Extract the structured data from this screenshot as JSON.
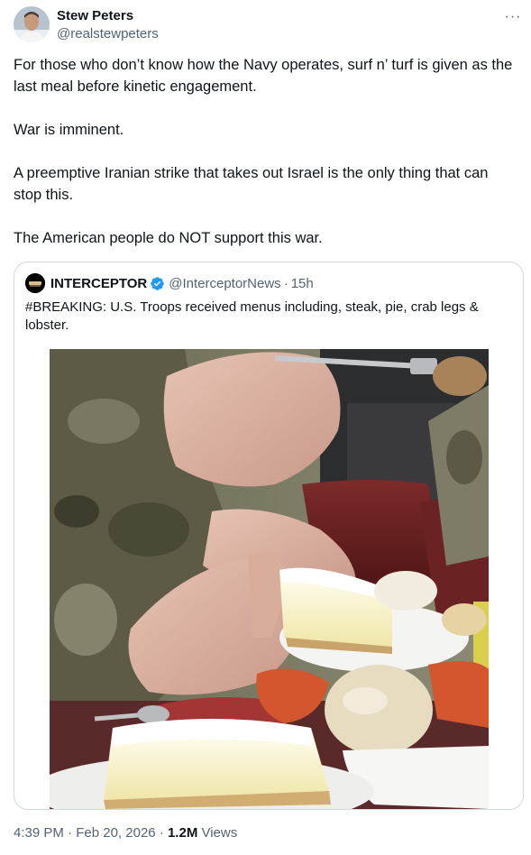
{
  "author": {
    "name": "Stew Peters",
    "handle": "@realstewpeters"
  },
  "more_label": "···",
  "tweet": {
    "paragraphs": [
      "For those who don’t know how the Navy operates, surf n’ turf is given as the last meal before kinetic engagement.",
      "War is imminent.",
      "A preemptive Iranian strike that takes out Israel is the only thing that can stop this.",
      "The American people do NOT support this war."
    ]
  },
  "quote": {
    "name": "INTERCEPTOR",
    "handle": "@InterceptorNews",
    "separator": "·",
    "time": "15h",
    "text": "#BREAKING: U.S. Troops received menus including, steak, pie, crab legs & lobster.",
    "verified_color": "#1d9bf0"
  },
  "footer": {
    "time": "4:39 PM",
    "sep1": " · ",
    "date": "Feb 20, 2026",
    "sep2": " · ",
    "views_count": "1.2M",
    "views_label": " Views"
  },
  "colors": {
    "text": "#0f1419",
    "secondary": "#536471",
    "border": "#cfd9de",
    "accent": "#1d9bf0"
  }
}
